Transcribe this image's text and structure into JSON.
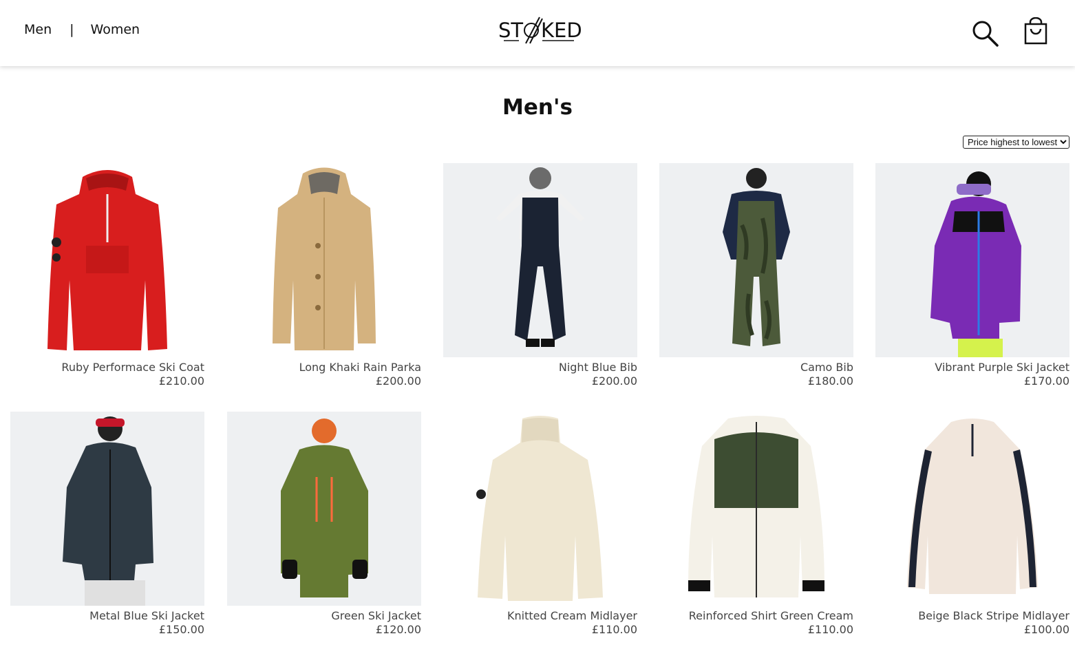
{
  "header": {
    "nav": [
      {
        "label": "Men"
      },
      {
        "label": "Women"
      }
    ],
    "separator": "|",
    "logo_text": "ST KED",
    "icons": {
      "search": "search-icon",
      "cart": "shopping-bag-icon"
    }
  },
  "page": {
    "title": "Men's",
    "sort": {
      "selected": "Price highest to lowest"
    }
  },
  "products": [
    {
      "name": "Ruby Performace Ski Coat",
      "price": "£210.00",
      "color": "#d81e1e"
    },
    {
      "name": "Long Khaki Rain Parka",
      "price": "£200.00",
      "color": "#d4b27f"
    },
    {
      "name": "Night Blue Bib",
      "price": "£200.00",
      "color": "#1b2333"
    },
    {
      "name": "Camo Bib",
      "price": "£180.00",
      "color": "#4c5a3a"
    },
    {
      "name": "Vibrant Purple Ski Jacket",
      "price": "£170.00",
      "color": "#7a2bb4"
    },
    {
      "name": "Metal Blue Ski Jacket",
      "price": "£150.00",
      "color": "#2e3a44"
    },
    {
      "name": "Green Ski Jacket",
      "price": "£120.00",
      "color": "#657a32"
    },
    {
      "name": "Knitted Cream Midlayer",
      "price": "£110.00",
      "color": "#efe7d2"
    },
    {
      "name": "Reinforced Shirt Green Cream",
      "price": "£110.00",
      "color": "#3d4d32"
    },
    {
      "name": "Beige Black Stripe Midlayer",
      "price": "£100.00",
      "color": "#f1e6dc"
    }
  ]
}
